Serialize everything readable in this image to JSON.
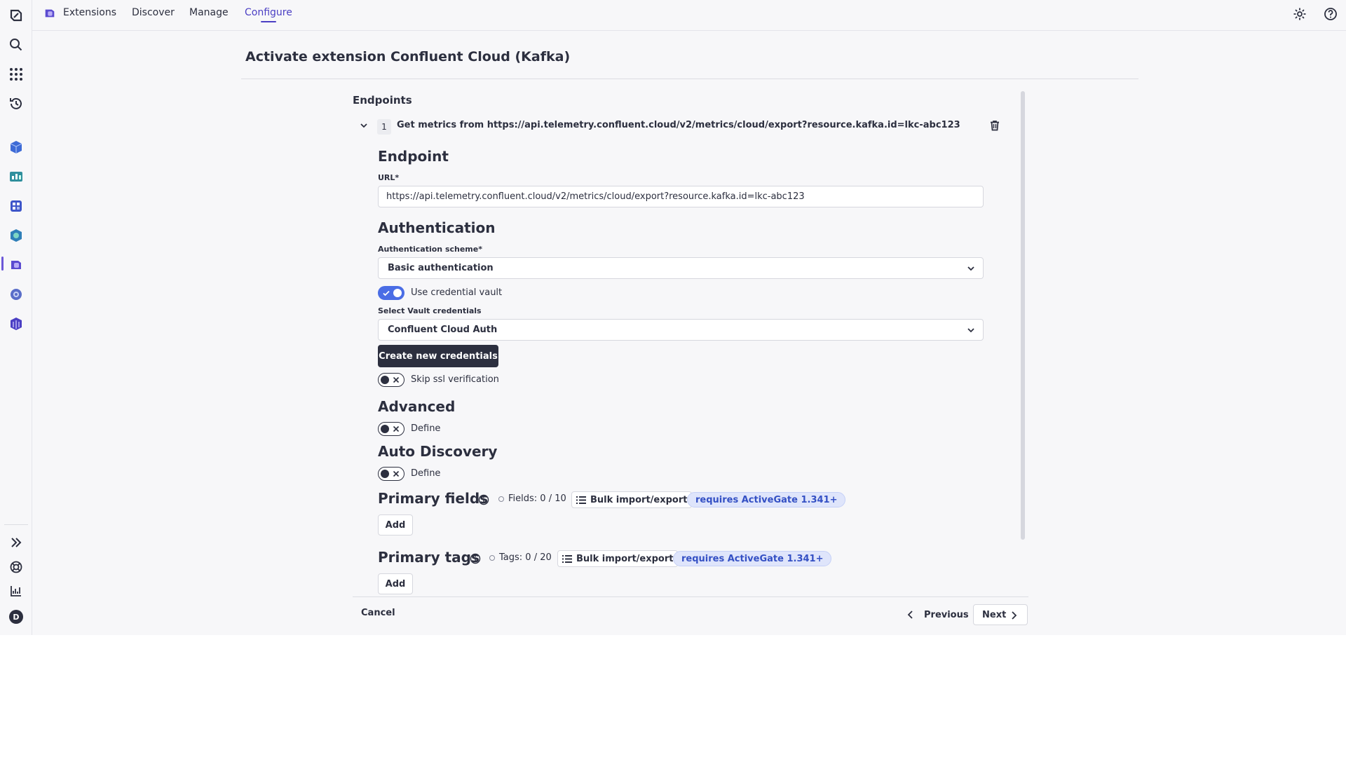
{
  "topnav": {
    "items": [
      {
        "label": "Extensions",
        "active": false
      },
      {
        "label": "Discover",
        "active": false
      },
      {
        "label": "Manage",
        "active": false
      },
      {
        "label": "Configure",
        "active": true
      }
    ]
  },
  "page": {
    "title": "Activate extension Confluent Cloud (Kafka)"
  },
  "endpoints": {
    "section_label": "Endpoints",
    "index": "1",
    "summary": "Get metrics from https://api.telemetry.confluent.cloud/v2/metrics/cloud/export?resource.kafka.id=lkc-abc123"
  },
  "endpoint_section": {
    "heading": "Endpoint",
    "url_label": "URL*",
    "url_value": "https://api.telemetry.confluent.cloud/v2/metrics/cloud/export?resource.kafka.id=lkc-abc123"
  },
  "authentication": {
    "heading": "Authentication",
    "scheme_label": "Authentication scheme*",
    "scheme_value": "Basic authentication",
    "vault_toggle_label": "Use credential vault",
    "vault_toggle_on": true,
    "vault_select_label": "Select Vault credentials",
    "vault_select_value": "Confluent Cloud Auth",
    "create_button": "Create new credentials",
    "ssl_toggle_label": "Skip ssl verification",
    "ssl_toggle_on": false
  },
  "advanced": {
    "heading": "Advanced",
    "toggle_label": "Define"
  },
  "auto_discovery": {
    "heading": "Auto Discovery",
    "toggle_label": "Define"
  },
  "primary_fields": {
    "heading": "Primary fields",
    "count": "Fields: 0 / 10",
    "bulk_label": "Bulk import/export",
    "requirement": "requires ActiveGate 1.341+",
    "add_label": "Add"
  },
  "primary_tags": {
    "heading": "Primary tags",
    "count": "Tags: 0 / 20",
    "bulk_label": "Bulk import/export",
    "requirement": "requires ActiveGate 1.341+",
    "add_label": "Add"
  },
  "footer": {
    "cancel": "Cancel",
    "previous": "Previous",
    "next": "Next"
  },
  "sidebar": {
    "profile_initial": "D"
  },
  "colors": {
    "accent": "#4b3fc4",
    "toggle_on": "#4a6de5",
    "pill_bg": "#dfe5fb",
    "pill_text": "#3450c4",
    "dark_button": "#2c2f3f"
  }
}
